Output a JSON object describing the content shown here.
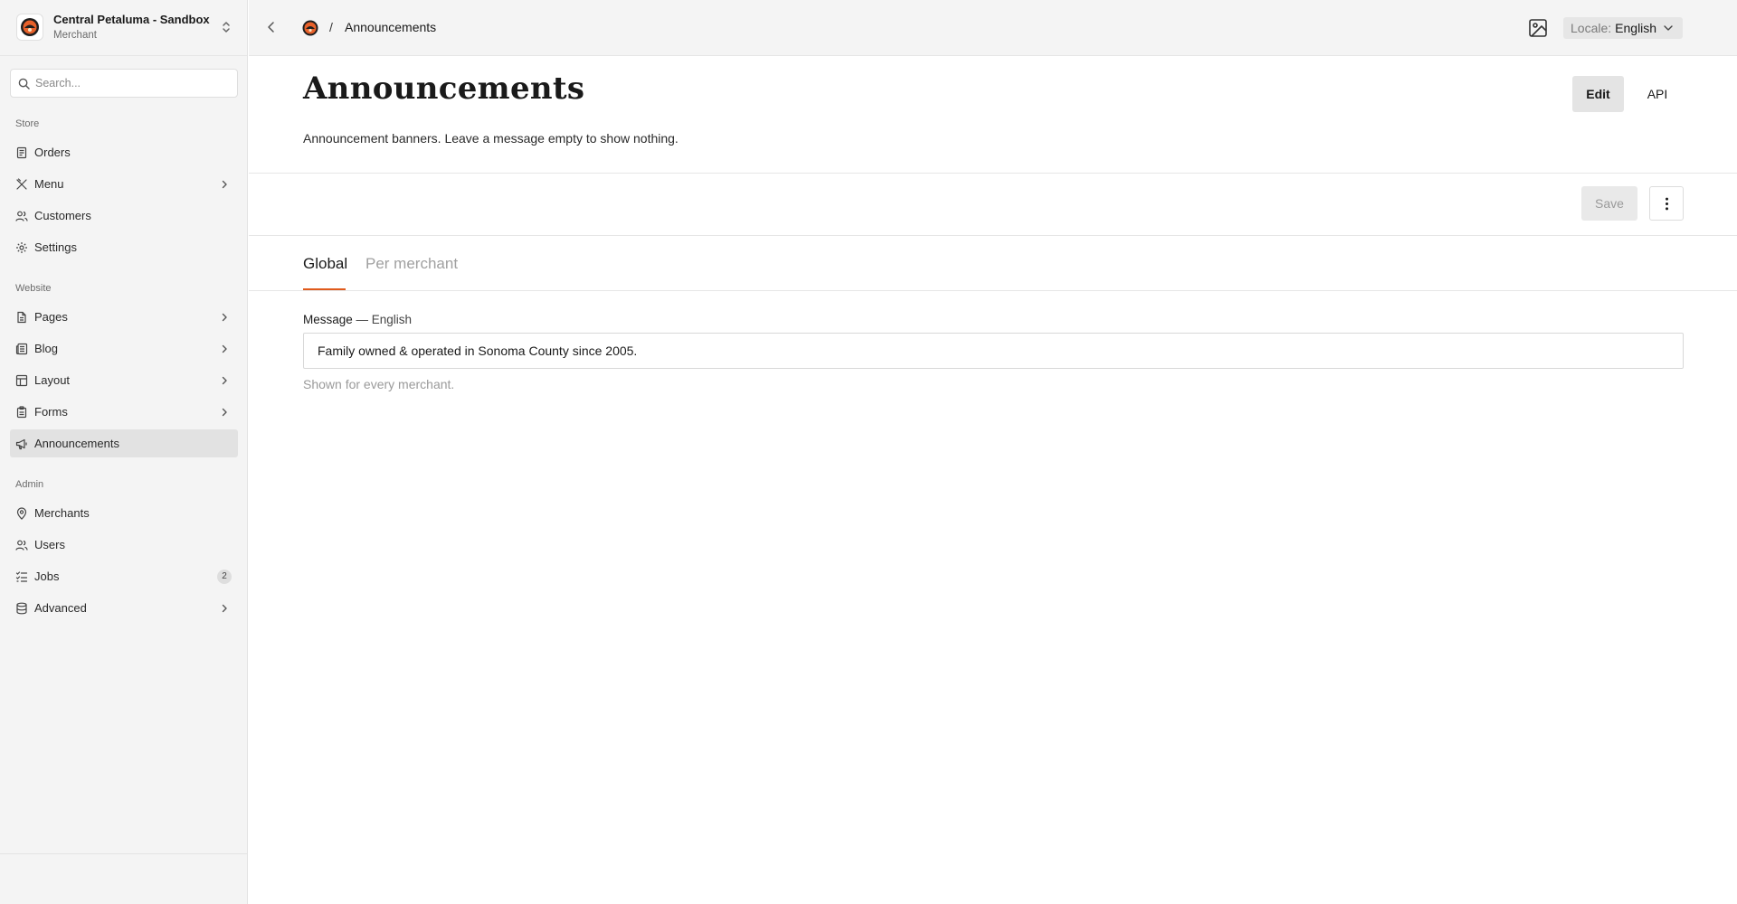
{
  "org": {
    "name": "Central Petaluma - Sandbox",
    "role": "Merchant"
  },
  "search": {
    "placeholder": "Search..."
  },
  "sidebar": {
    "sections": [
      {
        "label": "Store"
      },
      {
        "label": "Website"
      },
      {
        "label": "Admin"
      }
    ],
    "items": [
      {
        "label": "Orders",
        "icon": "receipt-icon"
      },
      {
        "label": "Menu",
        "icon": "utensils-icon",
        "expandable": true
      },
      {
        "label": "Customers",
        "icon": "users-icon"
      },
      {
        "label": "Settings",
        "icon": "gear-icon"
      },
      {
        "label": "Pages",
        "icon": "file-icon",
        "expandable": true
      },
      {
        "label": "Blog",
        "icon": "newspaper-icon",
        "expandable": true
      },
      {
        "label": "Layout",
        "icon": "layout-icon",
        "expandable": true
      },
      {
        "label": "Forms",
        "icon": "clipboard-icon",
        "expandable": true
      },
      {
        "label": "Announcements",
        "icon": "megaphone-icon",
        "active": true
      },
      {
        "label": "Merchants",
        "icon": "map-pin-icon"
      },
      {
        "label": "Users",
        "icon": "users-icon"
      },
      {
        "label": "Jobs",
        "icon": "list-check-icon",
        "badge": "2"
      },
      {
        "label": "Advanced",
        "icon": "database-icon",
        "expandable": true
      }
    ]
  },
  "topbar": {
    "breadcrumb_separator": "/",
    "breadcrumb_current": "Announcements",
    "locale_prefix": "Locale:",
    "locale_value": "English"
  },
  "header": {
    "title": "Announcements",
    "description": "Announcement banners. Leave a message empty to show nothing.",
    "edit_label": "Edit",
    "api_label": "API"
  },
  "actions": {
    "save_label": "Save"
  },
  "tabs": [
    {
      "label": "Global",
      "active": true
    },
    {
      "label": "Per merchant",
      "active": false
    }
  ],
  "form": {
    "field_label": "Message",
    "field_lang": " — English",
    "value": "Family owned & operated in Sonoma County since 2005.",
    "help": "Shown for every merchant."
  },
  "colors": {
    "accent": "#e05a1c",
    "sidebar_bg": "#f4f4f4",
    "active_item_bg": "#e2e2e2"
  }
}
